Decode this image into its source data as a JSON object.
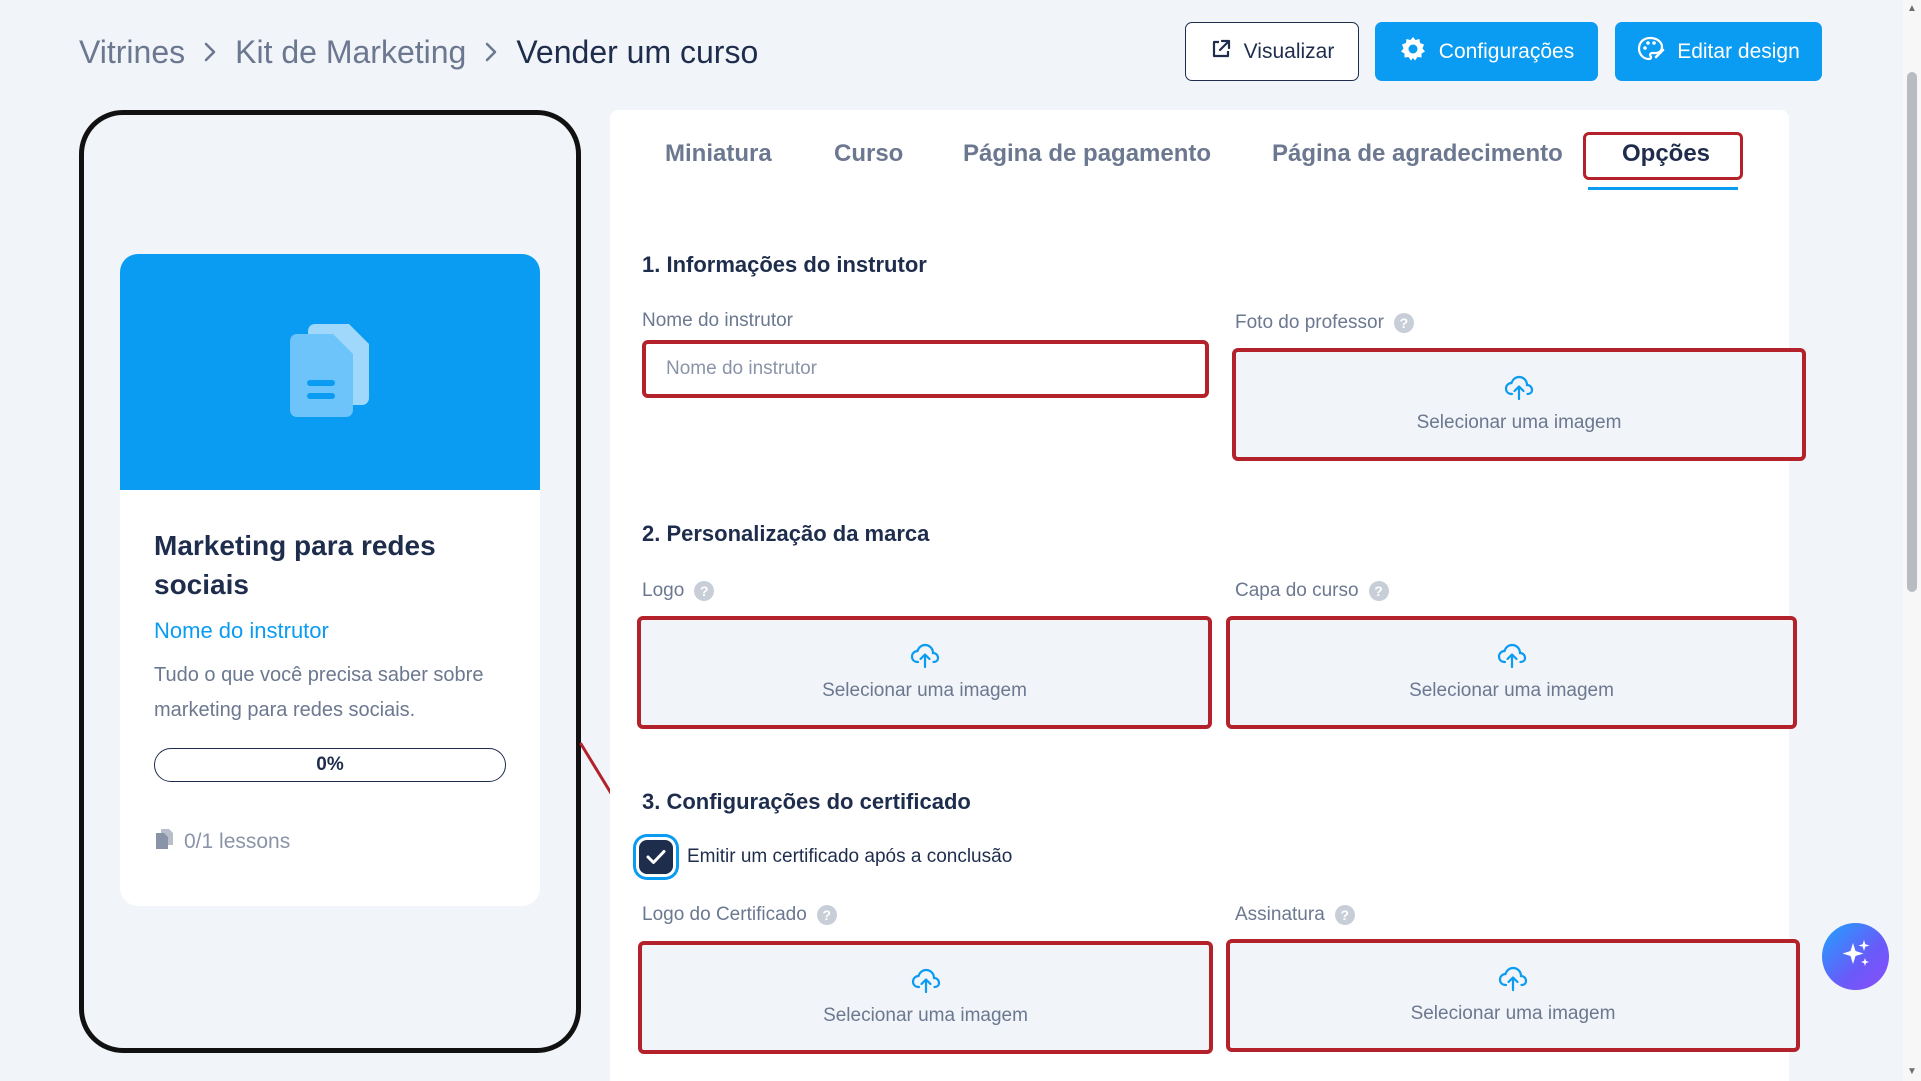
{
  "breadcrumb": {
    "items": [
      "Vitrines",
      "Kit de Marketing"
    ],
    "current": "Vender um curso"
  },
  "toolbar": {
    "preview_label": "Visualizar",
    "settings_label": "Configurações",
    "design_label": "Editar design"
  },
  "preview": {
    "course_title": "Marketing para redes sociais",
    "instructor": "Nome do instrutor",
    "description": "Tudo o que você precisa saber sobre marketing para redes sociais.",
    "progress": "0%",
    "lessons": "0/1 lessons"
  },
  "tabs": [
    {
      "label": "Miniatura",
      "active": false
    },
    {
      "label": "Curso",
      "active": false
    },
    {
      "label": "Página de pagamento",
      "active": false
    },
    {
      "label": "Página de agradecimento",
      "active": false
    },
    {
      "label": "Opções",
      "active": true
    }
  ],
  "sections": {
    "instructor": {
      "title": "1. Informações do instrutor",
      "name_label": "Nome do instrutor",
      "name_placeholder": "Nome do instrutor",
      "name_value": "",
      "photo_label": "Foto do professor"
    },
    "branding": {
      "title": "2. Personalização da marca",
      "logo_label": "Logo",
      "cover_label": "Capa do curso"
    },
    "certificate": {
      "title": "3. Configurações do certificado",
      "issue_label": "Emitir um certificado após a conclusão",
      "issue_checked": true,
      "logo_label": "Logo do Certificado",
      "signature_label": "Assinatura"
    }
  },
  "upload": {
    "label": "Selecionar uma imagem"
  },
  "colors": {
    "accent": "#0a9bf2",
    "text": "#1f2d4d",
    "muted": "#6b7890",
    "highlight": "#b3222a"
  }
}
